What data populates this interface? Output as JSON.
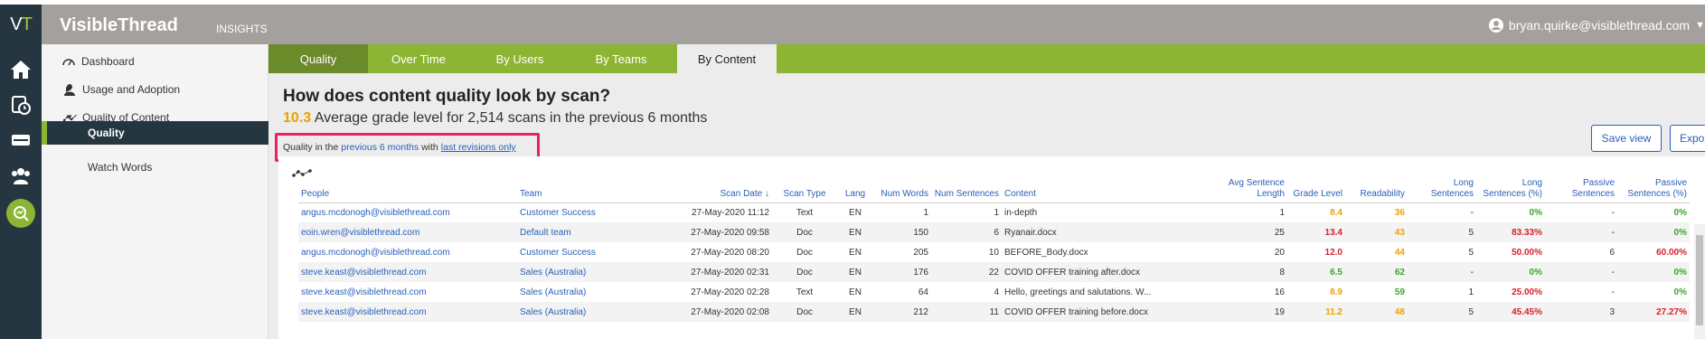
{
  "app": {
    "logo_text": "V",
    "logo_accent": "T",
    "brand": "VisibleThread",
    "insights_label": "INSIGHTS",
    "user_email": "bryan.quirke@visiblethread.com"
  },
  "rail_icons": [
    "home-icon",
    "history-icon",
    "document-icon",
    "team-icon",
    "search-insights-icon"
  ],
  "sidebar": {
    "items": [
      {
        "label": "Dashboard",
        "icon": "gauge-icon"
      },
      {
        "label": "Usage and Adoption",
        "icon": "person-icon"
      },
      {
        "label": "Quality of Content",
        "icon": "trend-icon"
      },
      {
        "label": "Quality"
      },
      {
        "label": "Watch Words"
      }
    ]
  },
  "tabs": [
    {
      "label": "Quality"
    },
    {
      "label": "Over Time"
    },
    {
      "label": "By Users"
    },
    {
      "label": "By Teams"
    },
    {
      "label": "By Content"
    }
  ],
  "content": {
    "title": "How does content quality look by scan?",
    "subtitle_num": "10.3",
    "subtitle_text": "Average grade level for 2,514 scans in the previous 6 months",
    "filter_prefix": "Quality in the",
    "filter_period": "previous 6 months",
    "filter_with": "with",
    "filter_revisions": "last revisions only",
    "save_view": "Save view",
    "export": "Export"
  },
  "table": {
    "headers": {
      "people": "People",
      "team": "Team",
      "scan_date": "Scan Date",
      "scan_type": "Scan Type",
      "lang": "Lang",
      "num_words": "Num Words",
      "num_sentences": "Num Sentences",
      "content": "Content",
      "avg_sentence_length": "Avg Sentence Length",
      "grade_level": "Grade Level",
      "readability": "Readability",
      "long_sentences": "Long Sentences",
      "long_sentences_pct": "Long Sentences (%)",
      "passive_sentences": "Passive Sentences",
      "passive_sentences_pct": "Passive Sentences (%)"
    },
    "rows": [
      {
        "people": "angus.mcdonogh@visiblethread.com",
        "team": "Customer Success",
        "date": "27-May-2020 11:12",
        "type": "Text",
        "lang": "EN",
        "words": "1",
        "sentences": "1",
        "content": "in-depth",
        "avg": "1",
        "grade": "8.4",
        "readability": "36",
        "long": "-",
        "long_pct": "0%",
        "passive": "-",
        "passive_pct": "0%"
      },
      {
        "people": "eoin.wren@visiblethread.com",
        "team": "Default team",
        "date": "27-May-2020 09:58",
        "type": "Doc",
        "lang": "EN",
        "words": "150",
        "sentences": "6",
        "content": "Ryanair.docx",
        "avg": "25",
        "grade": "13.4",
        "readability": "43",
        "long": "5",
        "long_pct": "83.33%",
        "passive": "-",
        "passive_pct": "0%"
      },
      {
        "people": "angus.mcdonogh@visiblethread.com",
        "team": "Customer Success",
        "date": "27-May-2020 08:20",
        "type": "Doc",
        "lang": "EN",
        "words": "205",
        "sentences": "10",
        "content": "BEFORE_Body.docx",
        "avg": "20",
        "grade": "12.0",
        "readability": "44",
        "long": "5",
        "long_pct": "50.00%",
        "passive": "6",
        "passive_pct": "60.00%"
      },
      {
        "people": "steve.keast@visiblethread.com",
        "team": "Sales (Australia)",
        "date": "27-May-2020 02:31",
        "type": "Doc",
        "lang": "EN",
        "words": "176",
        "sentences": "22",
        "content": "COVID OFFER training after.docx",
        "avg": "8",
        "grade": "6.5",
        "readability": "62",
        "long": "-",
        "long_pct": "0%",
        "passive": "-",
        "passive_pct": "0%"
      },
      {
        "people": "steve.keast@visiblethread.com",
        "team": "Sales (Australia)",
        "date": "27-May-2020 02:28",
        "type": "Text",
        "lang": "EN",
        "words": "64",
        "sentences": "4",
        "content": "Hello, greetings and salutations. W...",
        "avg": "16",
        "grade": "8.9",
        "readability": "59",
        "long": "1",
        "long_pct": "25.00%",
        "passive": "-",
        "passive_pct": "0%"
      },
      {
        "people": "steve.keast@visiblethread.com",
        "team": "Sales (Australia)",
        "date": "27-May-2020 02:08",
        "type": "Doc",
        "lang": "EN",
        "words": "212",
        "sentences": "11",
        "content": "COVID OFFER training before.docx",
        "avg": "19",
        "grade": "11.2",
        "readability": "48",
        "long": "5",
        "long_pct": "45.45%",
        "passive": "3",
        "passive_pct": "27.27%"
      }
    ],
    "grade_colors": [
      "orange",
      "red",
      "red",
      "green",
      "orange",
      "orange"
    ],
    "readability_colors": [
      "orange",
      "orange",
      "orange",
      "green",
      "green",
      "orange"
    ],
    "long_pct_colors": [
      "green",
      "red",
      "red",
      "green",
      "red",
      "red"
    ],
    "passive_pct_colors": [
      "green",
      "green",
      "red",
      "green",
      "green",
      "red"
    ]
  },
  "colors": {
    "accent_green": "#8cb533",
    "dark_tab": "#6b8a2a",
    "nav_dark": "#263641",
    "link_blue": "#2a60b8",
    "highlight_pink": "#e8215f"
  }
}
